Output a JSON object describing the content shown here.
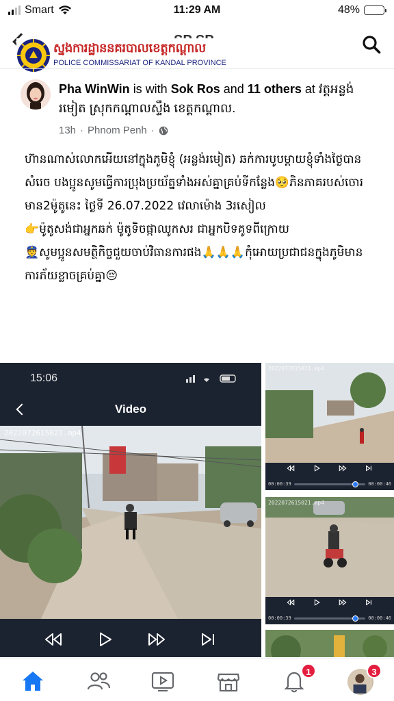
{
  "status_bar": {
    "carrier": "Smart",
    "time": "11:29 AM",
    "battery": "48%",
    "battery_level": 0.48
  },
  "header": {
    "title": "SP SP",
    "banner_kh": "ស្នងការដ្ឋាននគរបាលខេត្តកណ្ដាល",
    "banner_en": "POLICE COMMISSARIAT OF KANDAL PROVINCE"
  },
  "post": {
    "author": "Pha WinWin",
    "with_text": "is with",
    "tagged": "Sok Ros",
    "and_text": "and",
    "others": "11 others",
    "at_text": "at",
    "location": "វត្តអន្លង់រមៀត ស្រុកកណ្ដាលស្ទឹង ខេត្តកណ្ដាល.",
    "time": "13h",
    "place": "Phnom Penh",
    "body": [
      "ហ៊ានណាស់លោកអើយនៅក្នុងភូមិខ្ញុំ (អន្លង់រមៀត) ឆក់ការបូបម្ដាយខ្ញុំទាំងថ្ងៃបានសំរេច បងប្អូនសូមធ្វើការប្រុងប្រយ័ត្នទាំងអស់គ្នាគ្រប់ទីកន្លែង🥺ភិនភាគរបស់ចោរមាន2ម៉ូតូនេះ ថ្ងៃទី 26.07.2022 វេលាម៉ោង 3រសៀល",
      "👉ម៉ូតូសង់ជាអ្នកឆក់ ម៉ូតូទិចផ្កាឈូកសរ ជាអ្នកបិទគូទពីក្រោយ",
      "👮សូមប្អូនសមត្ថិកិច្ចជួយចាប់វិធានការផង🙏🙏🙏កុំអោយប្រជាជនក្នុងភូមិមានការភ័យខ្លាចគ្រប់គ្នា😔"
    ]
  },
  "media": {
    "main": {
      "phone_time": "15:06",
      "screen_title": "Video",
      "stamp": "2022072615021.mp4"
    },
    "clip1": {
      "stamp": "2022072615021.mp4",
      "current": "00:00:39",
      "total": "00:00:46",
      "progress": 0.85
    },
    "clip2": {
      "stamp": "2022072615021.mp4",
      "current": "00:00:39",
      "total": "00:00:46",
      "progress": 0.85
    }
  },
  "tabbar": {
    "items": [
      "home-icon",
      "friends-icon",
      "watch-icon",
      "marketplace-icon",
      "notifications-icon",
      "menu-icon"
    ],
    "notifications_badge": "1",
    "menu_badge": "3",
    "accent": "#1877f2"
  }
}
